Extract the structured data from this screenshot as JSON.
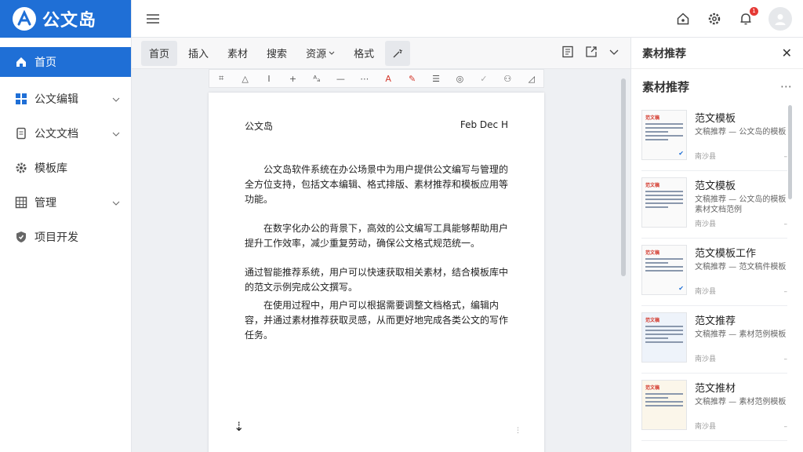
{
  "app": {
    "title": "公文岛",
    "accent": "#1f6fd6"
  },
  "sidebar": {
    "items": [
      {
        "label": "首页",
        "icon": "home-icon",
        "active": true
      },
      {
        "label": "公文编辑",
        "icon": "grid-icon",
        "expandable": true
      },
      {
        "label": "公文文档",
        "icon": "document-icon",
        "expandable": true
      },
      {
        "label": "模板库",
        "icon": "gear-icon"
      },
      {
        "label": "管理",
        "icon": "table-icon",
        "expandable": true
      },
      {
        "label": "项目开发",
        "icon": "shield-icon"
      }
    ]
  },
  "header": {
    "icons": [
      "menu-icon",
      "home-icon",
      "settings-icon",
      "bell-icon",
      "avatar"
    ],
    "notification_count": "1"
  },
  "menubar": {
    "items": [
      "首页",
      "插入",
      "素材",
      "搜索",
      "资源",
      "格式"
    ],
    "dropdown_index": 4
  },
  "document": {
    "header_left": "公文岛",
    "header_right": "Feb Dec H",
    "paragraphs": [
      "公文岛软件系统在办公场景中为用户提供公文编写与管理的全方位支持，包括文本编辑、格式排版、素材推荐和模板应用等功能。",
      "在数字化办公的背景下，高效的公文编写工具能够帮助用户提升工作效率，减少重复劳动，确保公文格式规范统一。",
      "通过智能推荐系统，用户可以快速获取相关素材，结合模板库中的范文示例完成公文撰写。",
      "在使用过程中，用户可以根据需要调整文档格式，编辑内容，并通过素材推荐获取灵感，从而更好地完成各类公文的写作任务。"
    ]
  },
  "panel": {
    "title": "素材推荐",
    "subtitle": "素材推荐",
    "cards": [
      {
        "title": "范文模板",
        "desc": "文稿推荐 — 公文岛的模板",
        "meta": "南沙县"
      },
      {
        "title": "范文模板",
        "desc": "文稿推荐 — 公文岛的模板素材文档范例",
        "meta": "南沙县"
      },
      {
        "title": "范文模板工作",
        "desc": "文稿推荐 — 范文稿件模板",
        "meta": "南沙县"
      },
      {
        "title": "范文推荐",
        "desc": "文稿推荐 — 素材范例模板",
        "meta": "南沙县"
      },
      {
        "title": "范文推材",
        "desc": "文稿推荐 — 素材范例模板",
        "meta": "南沙县"
      }
    ],
    "thumb_label": "范文稿"
  }
}
